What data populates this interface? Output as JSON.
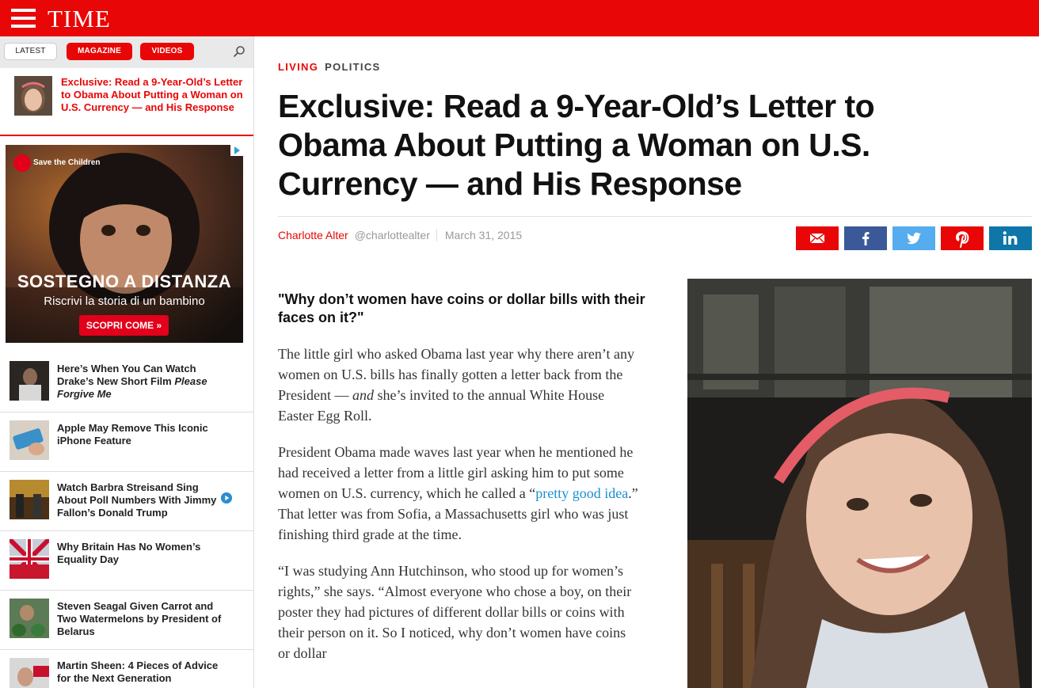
{
  "header": {
    "logo": "TIME"
  },
  "sidebar": {
    "tabs": {
      "latest": "LATEST",
      "magazine": "MAGAZINE",
      "videos": "VIDEOS"
    },
    "current_story": "Exclusive: Read a 9-Year-Old’s Letter to Obama About Putting a Woman on U.S. Currency — and His Response",
    "ad": {
      "brand": "Save the Children",
      "headline": "SOSTEGNO A DISTANZA",
      "subline": "Riscrivi la storia di un bambino",
      "cta": "SCOPRI COME »"
    },
    "items": [
      {
        "title_a": "Here’s When You Can Watch Drake’s New Short Film ",
        "title_b": "Please Forgive Me"
      },
      {
        "title_a": "Apple May Remove This Iconic iPhone Feature",
        "title_b": ""
      },
      {
        "title_a": "Watch Barbra Streisand Sing About Poll Numbers With Jimmy Fallon’s Donald Trump",
        "title_b": ""
      },
      {
        "title_a": "Why Britain Has No Women’s Equality Day",
        "title_b": ""
      },
      {
        "title_a": "Steven Seagal Given Carrot and Two Watermelons by President of Belarus",
        "title_b": ""
      },
      {
        "title_a": "Martin Sheen: 4 Pieces of Advice for the Next Generation",
        "title_b": ""
      }
    ]
  },
  "article": {
    "categories": [
      "LIVING",
      "POLITICS"
    ],
    "headline": "Exclusive: Read a 9-Year-Old’s Letter to Obama About Putting a Woman on U.S. Currency — and His Response",
    "author": "Charlotte Alter",
    "handle": "@charlottealter",
    "date": "March 31, 2015",
    "lead_quote": "\"Why don’t women have coins or dollar bills with their faces on it?\"",
    "p1_a": "The little girl who asked Obama last year why there aren’t any women on U.S. bills has finally gotten a letter back from the President — ",
    "p1_em": "and",
    "p1_b": " she’s invited to the annual White House Easter Egg Roll.",
    "p2_a": "President Obama made waves last year when he mentioned he had received a letter from a little girl asking him to put some women on U.S. currency, which he called a “",
    "p2_link": "pretty good idea",
    "p2_b": ".” That letter was from Sofia, a Massachusetts girl who was just finishing third grade at the time.",
    "p3": "“I was studying Ann Hutchinson, who stood up for women’s rights,” she says. “Almost everyone who chose a boy, on their poster they had pictures of different dollar bills or coins with their person on it. So I noticed, why don’t women have coins or dollar"
  },
  "share": {
    "icons": [
      "mail-icon",
      "facebook-icon",
      "twitter-icon",
      "pinterest-icon",
      "linkedin-icon"
    ],
    "colors": {
      "mail": "#e90606",
      "facebook": "#3b5998",
      "twitter": "#55acee",
      "pinterest": "#e90606",
      "linkedin": "#0e76a8"
    }
  },
  "colors": {
    "brand_red": "#e90606"
  }
}
